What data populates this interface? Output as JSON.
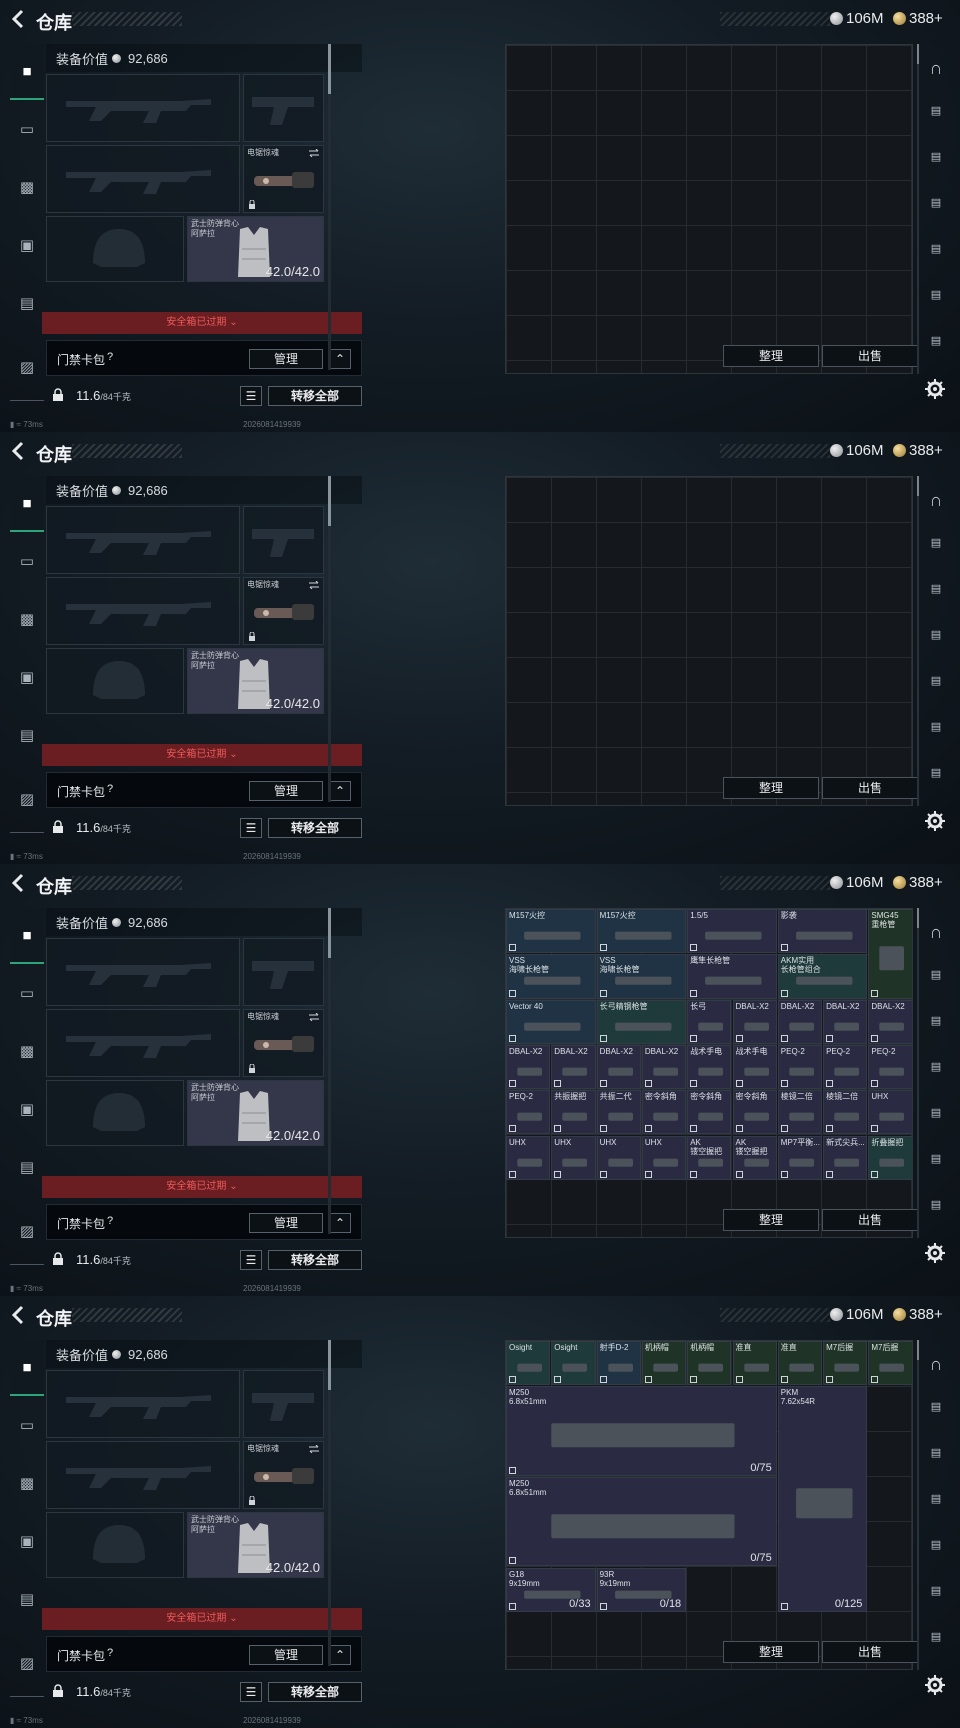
{
  "header": {
    "title": "仓库",
    "silver": "106M",
    "gold": "388+"
  },
  "equipment": {
    "value_label": "装备价值",
    "value": "92,686",
    "mod_slot_name": "电锯惊魂",
    "vest_name": "武士防弹背心\n阿萨拉",
    "vest_durability": "42.0/42.0",
    "expired_label": "安全箱已过期",
    "keybag_label": "门禁卡包",
    "keybag_help": "?",
    "manage_label": "管理",
    "weight": "11.6",
    "weight_max": "/84千克",
    "transfer_all_label": "转移全部"
  },
  "status": {
    "ping": "73ms",
    "build_id": "2026081419939"
  },
  "actions": {
    "organize_label": "整理",
    "sell_label": "出售"
  },
  "screens": [
    {
      "name": "empty-1",
      "items": []
    },
    {
      "name": "empty-2",
      "items": []
    },
    {
      "name": "attachments",
      "items": [
        {
          "label": "M157火控",
          "color": "blue"
        },
        {
          "label": "M157火控",
          "color": "blue"
        },
        {
          "label": "1.5/5",
          "color": "purple"
        },
        {
          "label": "影袭",
          "color": "purple"
        },
        {
          "label": "SMG45\n重枪管",
          "color": "green"
        },
        {
          "label": "VSS\n海啸长枪管",
          "color": "blue"
        },
        {
          "label": "VSS\n海啸长枪管",
          "color": "blue"
        },
        {
          "label": "鹰隼长枪管",
          "color": "purple"
        },
        {
          "label": "AKM实用\n长枪管组合",
          "color": "teal"
        },
        {
          "label": "Vector 40",
          "color": "blue"
        },
        {
          "label": "长弓精钢枪管",
          "color": "teal"
        },
        {
          "label": "长弓",
          "color": "purple"
        },
        {
          "label": "DBAL-X2",
          "color": "purple"
        },
        {
          "label": "DBAL-X2",
          "color": "purple"
        },
        {
          "label": "DBAL-X2",
          "color": "purple"
        },
        {
          "label": "DBAL-X2",
          "color": "purple"
        },
        {
          "label": "DBAL-X2",
          "color": "purple"
        },
        {
          "label": "DBAL-X2",
          "color": "purple"
        },
        {
          "label": "DBAL-X2",
          "color": "purple"
        },
        {
          "label": "DBAL-X2",
          "color": "purple"
        },
        {
          "label": "战术手电",
          "color": "purple"
        },
        {
          "label": "战术手电",
          "color": "purple"
        },
        {
          "label": "PEQ-2",
          "color": "purple"
        },
        {
          "label": "PEQ-2",
          "color": "purple"
        },
        {
          "label": "PEQ-2",
          "color": "purple"
        },
        {
          "label": "PEQ-2",
          "color": "purple"
        },
        {
          "label": "共振握把",
          "color": "purple"
        },
        {
          "label": "共振二代",
          "color": "purple"
        },
        {
          "label": "密令斜角",
          "color": "purple"
        },
        {
          "label": "密令斜角",
          "color": "purple"
        },
        {
          "label": "密令斜角",
          "color": "purple"
        },
        {
          "label": "棱镜二倍",
          "color": "purple"
        },
        {
          "label": "棱镜二倍",
          "color": "purple"
        },
        {
          "label": "UHX",
          "color": "purple"
        },
        {
          "label": "UHX",
          "color": "purple"
        },
        {
          "label": "UHX",
          "color": "purple"
        },
        {
          "label": "UHX",
          "color": "purple"
        },
        {
          "label": "UHX",
          "color": "purple"
        },
        {
          "label": "AK\n镂空握把",
          "color": "purple"
        },
        {
          "label": "AK\n镂空握把",
          "color": "purple"
        },
        {
          "label": "MP7平衡...",
          "color": "purple"
        },
        {
          "label": "新式尖兵...",
          "color": "purple"
        },
        {
          "label": "折叠握把",
          "color": "teal"
        }
      ]
    },
    {
      "name": "weapons",
      "items": [
        {
          "label": "Osight",
          "color": "teal"
        },
        {
          "label": "Osight",
          "color": "teal"
        },
        {
          "label": "射手D-2",
          "color": "blue"
        },
        {
          "label": "机柄帽",
          "color": "green"
        },
        {
          "label": "机柄帽",
          "color": "green"
        },
        {
          "label": "准直",
          "color": "green"
        },
        {
          "label": "准直",
          "color": "green"
        },
        {
          "label": "M7后握",
          "color": "green"
        },
        {
          "label": "M7后握",
          "color": "green"
        },
        {
          "label": "M250\n6.8x51mm",
          "count": "0/75",
          "color": "purple"
        },
        {
          "label": "PKM\n7.62x54R",
          "count": "0/125",
          "color": "purple"
        },
        {
          "label": "M250\n6.8x51mm",
          "count": "0/75",
          "color": "purple"
        },
        {
          "label": "G18\n9x19mm",
          "count": "0/33",
          "color": "purple"
        },
        {
          "label": "93R\n9x19mm",
          "count": "0/18",
          "color": "purple"
        }
      ]
    }
  ]
}
